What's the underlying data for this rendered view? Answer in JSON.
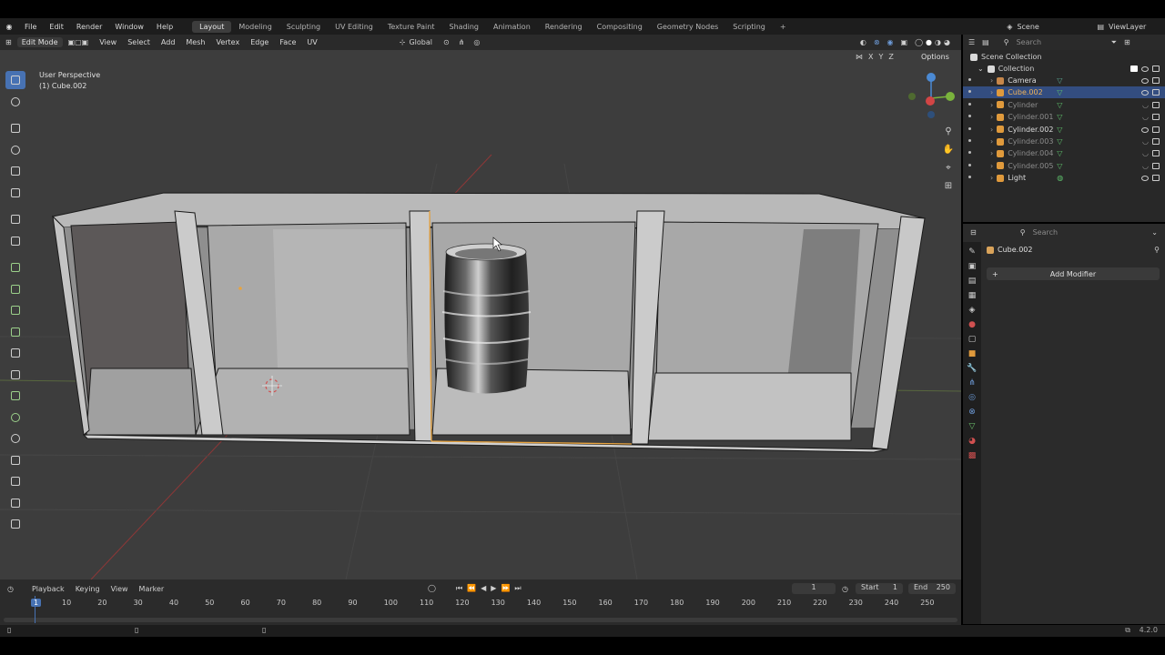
{
  "menu": [
    "File",
    "Edit",
    "Render",
    "Window",
    "Help"
  ],
  "workspaces": [
    "Layout",
    "Modeling",
    "Sculpting",
    "UV Editing",
    "Texture Paint",
    "Shading",
    "Animation",
    "Rendering",
    "Compositing",
    "Geometry Nodes",
    "Scripting"
  ],
  "active_workspace": "Layout",
  "scene": {
    "label": "Scene",
    "view_layer": "ViewLayer"
  },
  "viewport_header": {
    "mode": "Edit Mode",
    "menus": [
      "View",
      "Select",
      "Add",
      "Mesh",
      "Vertex",
      "Edge",
      "Face",
      "UV"
    ],
    "orientation": "Global",
    "options": "Options",
    "axes": [
      "X",
      "Y",
      "Z"
    ]
  },
  "overlay_text": {
    "perspective": "User Perspective",
    "object": "(1) Cube.002"
  },
  "outliner": {
    "search_placeholder": "Search",
    "scene_collection": "Scene Collection",
    "collection": "Collection",
    "items": [
      {
        "name": "Camera",
        "type": "camera",
        "selected": false,
        "dim": false
      },
      {
        "name": "Cube.002",
        "type": "mesh",
        "selected": true,
        "dim": false
      },
      {
        "name": "Cylinder",
        "type": "mesh",
        "selected": false,
        "dim": true
      },
      {
        "name": "Cylinder.001",
        "type": "mesh",
        "selected": false,
        "dim": true
      },
      {
        "name": "Cylinder.002",
        "type": "mesh",
        "selected": false,
        "dim": false
      },
      {
        "name": "Cylinder.003",
        "type": "mesh",
        "selected": false,
        "dim": true
      },
      {
        "name": "Cylinder.004",
        "type": "mesh",
        "selected": false,
        "dim": true
      },
      {
        "name": "Cylinder.005",
        "type": "mesh",
        "selected": false,
        "dim": true
      },
      {
        "name": "Light",
        "type": "light",
        "selected": false,
        "dim": false
      }
    ]
  },
  "properties": {
    "search_placeholder": "Search",
    "object_name": "Cube.002",
    "add_modifier": "Add Modifier"
  },
  "timeline": {
    "menus": [
      "Playback",
      "Keying",
      "View",
      "Marker"
    ],
    "current_frame": "1",
    "start_label": "Start",
    "start": "1",
    "end_label": "End",
    "end": "250",
    "ruler": [
      "1",
      "10",
      "20",
      "30",
      "40",
      "50",
      "60",
      "70",
      "80",
      "90",
      "100",
      "110",
      "120",
      "130",
      "140",
      "150",
      "160",
      "170",
      "180",
      "190",
      "200",
      "210",
      "220",
      "230",
      "240",
      "250"
    ]
  },
  "status": {
    "version": "4.2.0"
  },
  "colors": {
    "accent": "#4772b3",
    "selected_edge": "#e8a33e",
    "x_axis": "#c23a3a",
    "y_axis": "#6a9a35"
  }
}
